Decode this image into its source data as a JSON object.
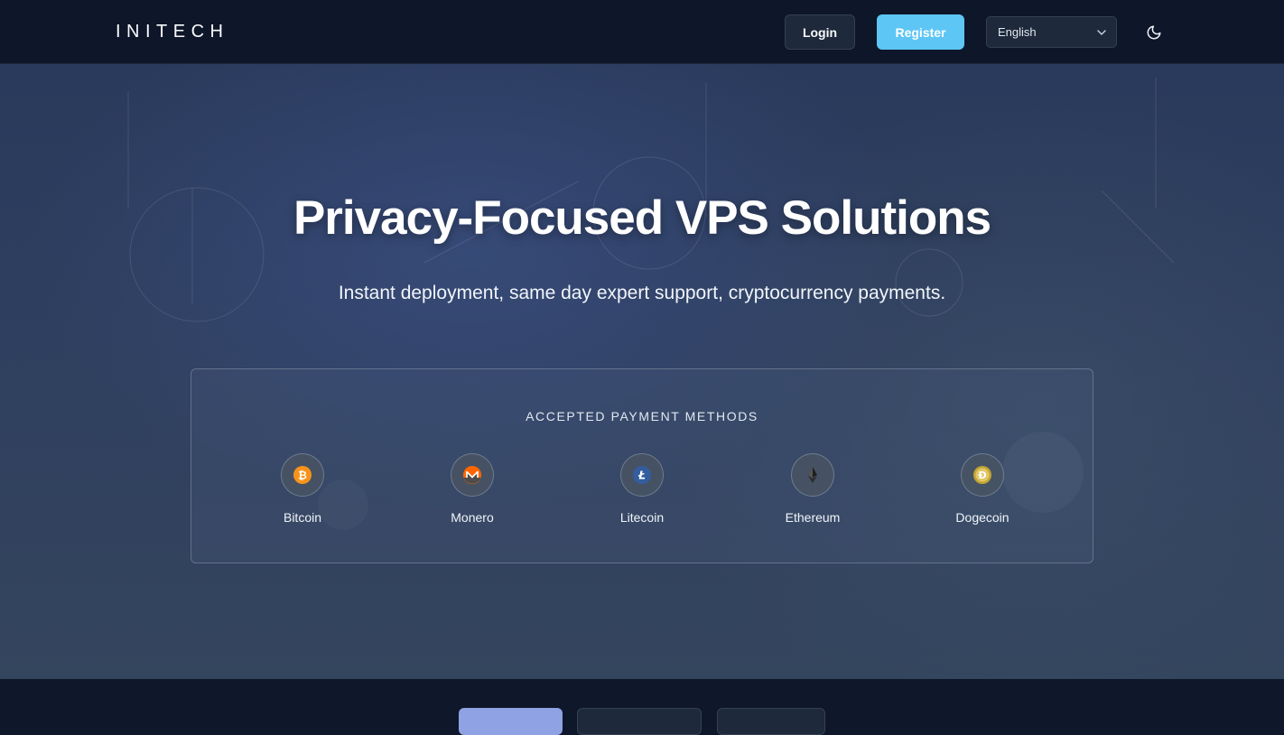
{
  "header": {
    "logo_text": "INITECH",
    "login_label": "Login",
    "register_label": "Register",
    "language_selected": "English",
    "theme_icon": "moon-icon"
  },
  "hero": {
    "title": "Privacy-Focused VPS Solutions",
    "subtitle": "Instant deployment, same day expert support, cryptocurrency payments."
  },
  "payments": {
    "heading": "ACCEPTED PAYMENT METHODS",
    "methods": [
      {
        "name": "Bitcoin",
        "icon": "bitcoin-icon",
        "color": "#f7931a"
      },
      {
        "name": "Monero",
        "icon": "monero-icon",
        "color": "#ff6600"
      },
      {
        "name": "Litecoin",
        "icon": "litecoin-icon",
        "color": "#345d9d"
      },
      {
        "name": "Ethereum",
        "icon": "ethereum-icon",
        "color": "#3c3c3d"
      },
      {
        "name": "Dogecoin",
        "icon": "dogecoin-icon",
        "color": "#c2a633"
      }
    ]
  },
  "colors": {
    "accent": "#5ec6f5",
    "header_bg": "#0e1629",
    "active_tab": "#8fa2e3"
  }
}
